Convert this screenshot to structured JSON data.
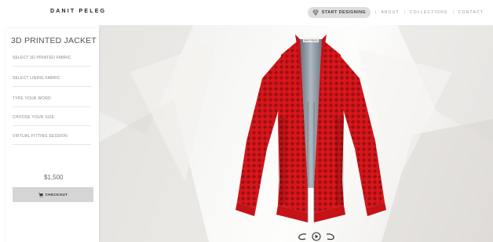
{
  "header": {
    "brand": "DANIT PELEG",
    "cta_label": "START DESIGNING",
    "cta_icon": "diamond-icon",
    "nav_links": [
      "ABOUT",
      "COLLECTIONS",
      "CONTACT"
    ],
    "separator": "|"
  },
  "sidebar": {
    "title": "3D PRINTED JACKET",
    "items": [
      {
        "label": "SELECT 3D PRINTED FABRIC"
      },
      {
        "label": "SELECT LINING FABRIC"
      },
      {
        "label": "TYPE YOUR WORD"
      },
      {
        "label": "CHOOSE YOUR SIZE"
      },
      {
        "label": "VIRTUAL FITTING SESSION"
      }
    ],
    "price": "$1,500",
    "checkout_label": "CHECKOUT",
    "checkout_icon": "cart-icon"
  },
  "product": {
    "collar_label": "DANIT PELEG",
    "jacket_color": "#d8161b"
  },
  "controls": {
    "icons": [
      "rotate-left-icon",
      "play-icon",
      "rotate-right-icon"
    ]
  },
  "colors": {
    "jacket": "#d8161b",
    "cta_bg": "#dedede",
    "checkout_bg": "#d5d5d5"
  }
}
